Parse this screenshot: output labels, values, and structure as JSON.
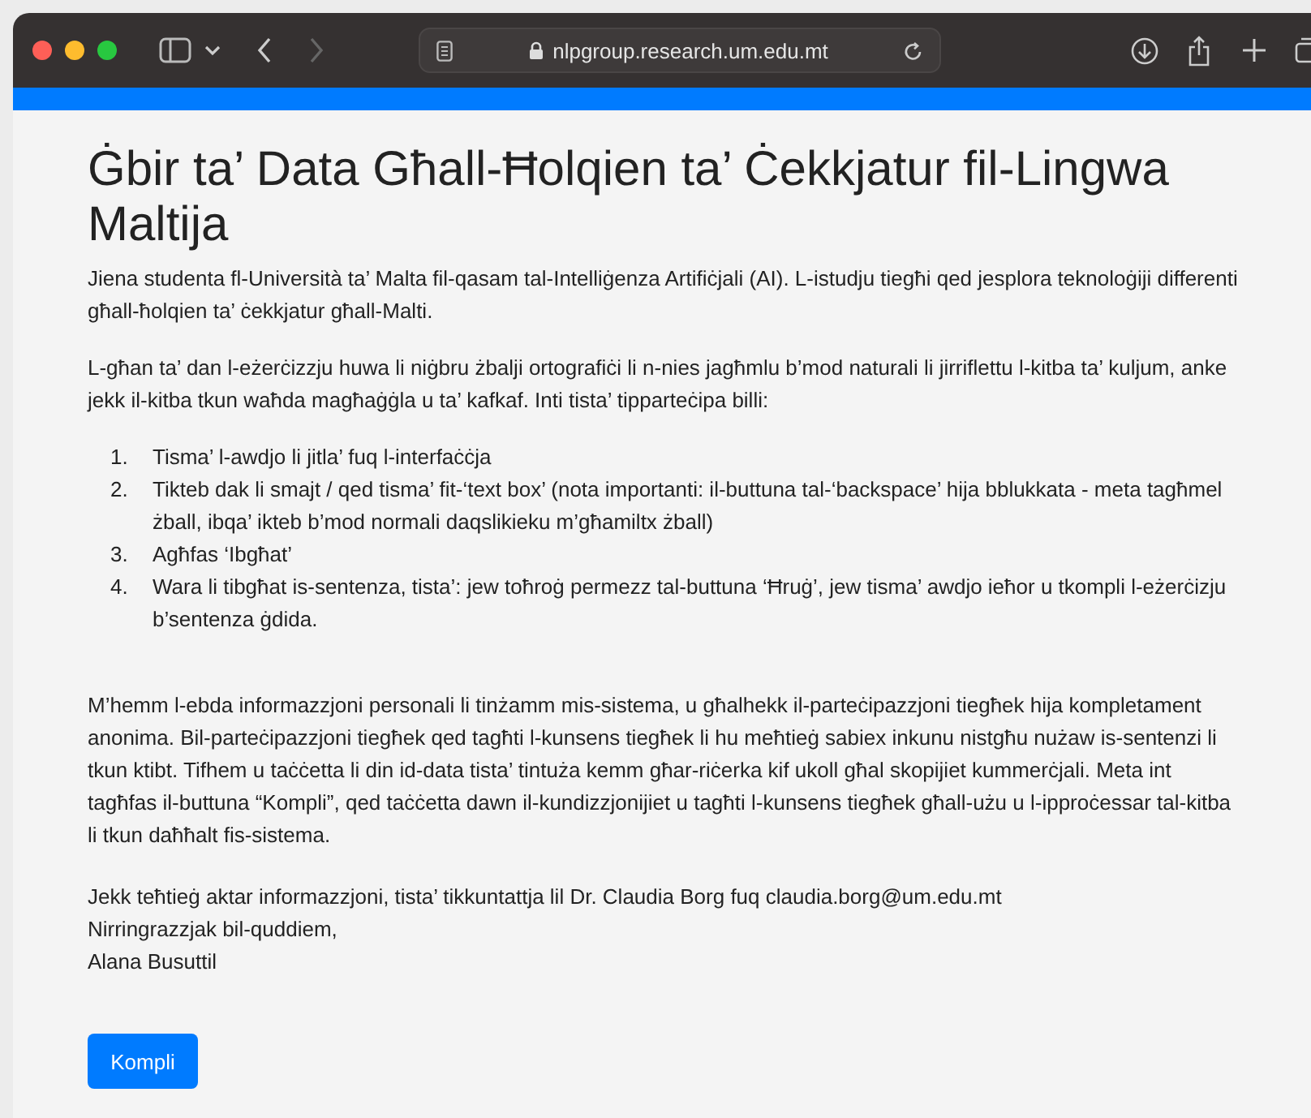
{
  "browser": {
    "url": "nlpgroup.research.um.edu.mt"
  },
  "page": {
    "title": "Ġbir ta’ Data Għall-Ħolqien ta’ Ċekkjatur fil-Lingwa Maltija",
    "intro": [
      "Jiena studenta fl-Università ta’ Malta fil-qasam tal-Intelliġenza Artifiċjali (AI). L-istudju tiegħi qed jesplora teknoloġiji differenti għall-ħolqien ta’ ċekkjatur għall-Malti.",
      "L-għan ta’ dan l-eżerċizzju huwa li niġbru żbalji ortografiċi li n-nies jagħmlu b’mod naturali li jirriflettu l-kitba ta’ kuljum, anke jekk il-kitba tkun waħda magħaġġla u ta’ kafkaf. Inti tista’ tipparteċipa billi:"
    ],
    "steps": [
      {
        "number": "1.",
        "text": "Tisma’ l-awdjo li jitla’ fuq l-interfaċċja"
      },
      {
        "number": "2.",
        "text": "Tikteb dak li smajt / qed tisma’ fit-‘text box’ (nota importanti: il-buttuna tal-‘backspace’ hija bblukkata - meta tagħmel żball, ibqa’ ikteb b’mod normali daqslikieku m’għamiltx żball)"
      },
      {
        "number": "3.",
        "text": "Agħfas ‘Ibgħat’"
      },
      {
        "number": "4.",
        "text": "Wara li tibgħat is-sentenza, tista’: jew toħroġ permezz tal-buttuna ‘Ħruġ’, jew tisma’ awdjo ieħor u tkompli l-eżerċizju b’sentenza ġdida."
      }
    ],
    "consent": "M’hemm l-ebda informazzjoni personali li tinżamm mis-sistema, u għalhekk il-parteċipazzjoni tiegħek hija kompletament anonima. Bil-parteċipazzjoni tiegħek qed tagħti l-kunsens tiegħek li hu meħtieġ sabiex inkunu nistgħu nużaw is-sentenzi li tkun ktibt. Tifhem u taċċetta li din id-data tista’ tintuża kemm għar-riċerka kif ukoll għal skopijiet kummerċjali. Meta int tagħfas il-buttuna “Kompli”, qed taċċetta dawn il-kundizzjonijiet u tagħti l-kunsens tiegħek għall-użu u l-ipproċessar tal-kitba li tkun daħħalt fis-sistema.",
    "contact": [
      "Jekk teħtieġ aktar informazzjoni, tista’ tikkuntattja lil Dr. Claudia Borg fuq claudia.borg@um.edu.mt",
      "Nirringrazzjak bil-quddiem,",
      "Alana Busuttil"
    ],
    "button": "Kompli"
  }
}
